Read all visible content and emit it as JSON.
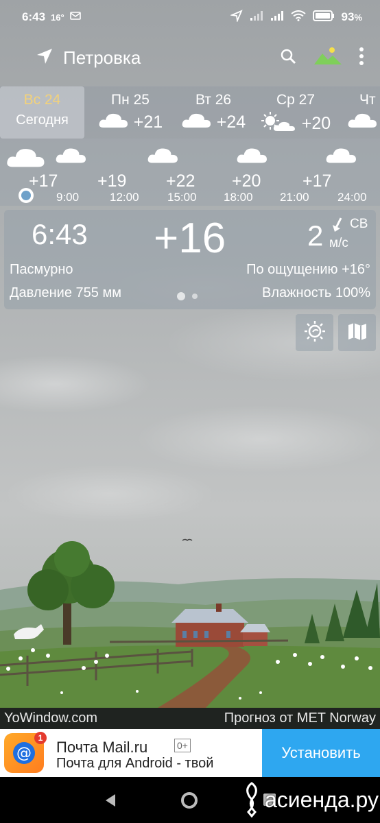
{
  "status_bar": {
    "time": "6:43",
    "temp_badge": "16°",
    "battery": "93"
  },
  "app_bar": {
    "city": "Петровка"
  },
  "days": [
    {
      "name": "Вс 24",
      "sub": "Сегодня",
      "selected": true
    },
    {
      "name": "Пн 25",
      "temp": "+21",
      "icon": "cloud-icon"
    },
    {
      "name": "Вт 26",
      "temp": "+24",
      "icon": "cloud-icon"
    },
    {
      "name": "Ср 27",
      "temp": "+20",
      "icon": "sun-cloud-icon"
    },
    {
      "name": "Чт",
      "icon": "cloud-icon"
    }
  ],
  "hourly": [
    {
      "temp": "+17",
      "time": "9:00"
    },
    {
      "temp": "+19",
      "time": "12:00"
    },
    {
      "temp": "+22",
      "time": "15:00"
    },
    {
      "temp": "+20",
      "time": "18:00"
    },
    {
      "temp": "+17",
      "time": "21:00"
    },
    {
      "temp": "",
      "time": "24:00"
    }
  ],
  "current": {
    "time": "6:43",
    "temp": "+16",
    "wind_speed": "2",
    "wind_dir": "СВ",
    "wind_unit": "м/с",
    "condition": "Пасмурно",
    "feels_like": "По ощущению +16°",
    "pressure": "Давление 755 мм",
    "humidity": "Влажность 100%"
  },
  "credits": {
    "left": "YoWindow.com",
    "right": "Прогноз от MET Norway"
  },
  "ad": {
    "badge": "1",
    "title": "Почта Mail.ru",
    "age": "0+",
    "subtitle": "Почта для Android - твой",
    "button": "Установить"
  },
  "watermark": "асиенда.ру",
  "colors": {
    "selected_day": "#f3d27a",
    "ad_button": "#2ea7f0",
    "ad_logo": "#ff9a22"
  }
}
